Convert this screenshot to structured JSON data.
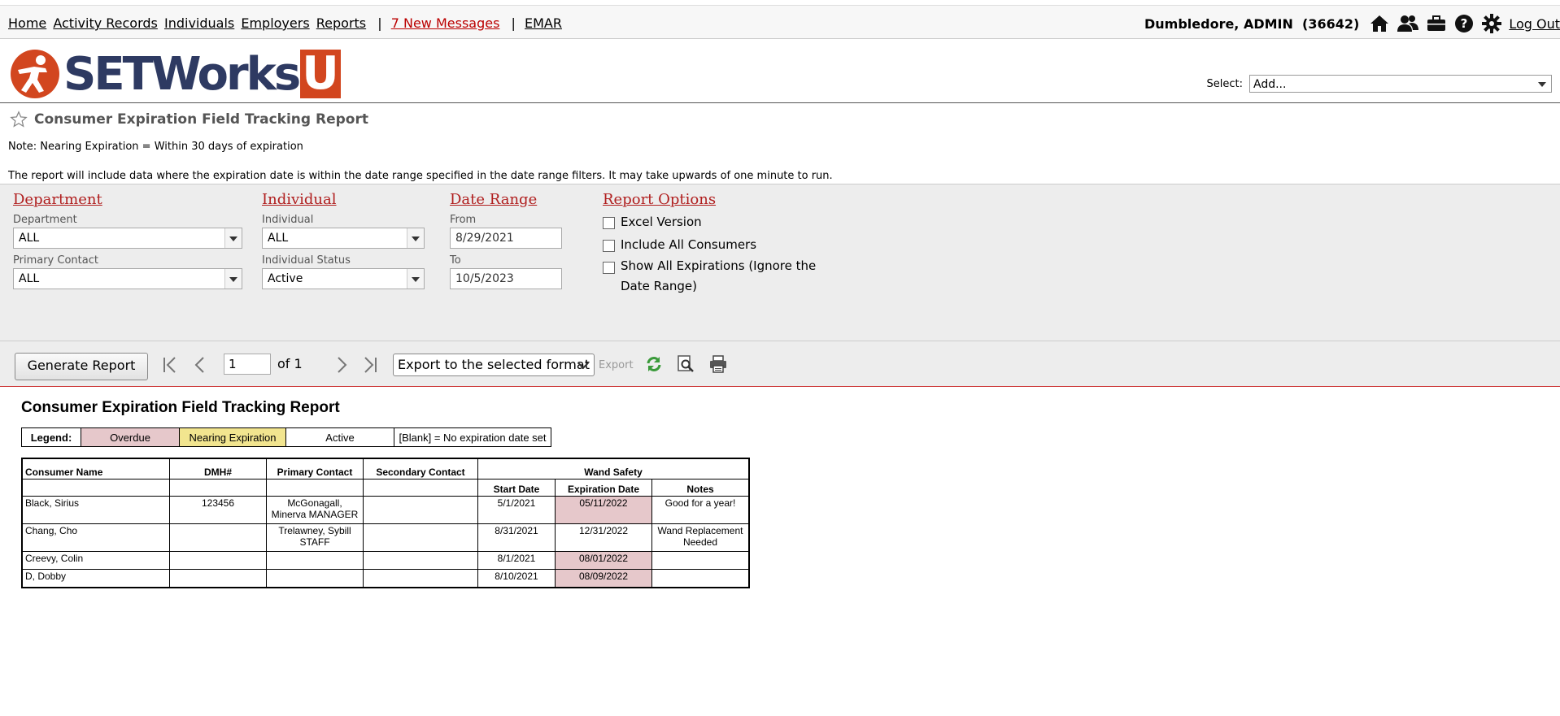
{
  "nav": {
    "home": "Home",
    "activity_records": "Activity Records",
    "individuals": "Individuals",
    "employers": "Employers",
    "reports": "Reports",
    "separator": "|",
    "messages": "7 New Messages",
    "emar": "EMAR"
  },
  "user": {
    "name": "Dumbledore, ADMIN",
    "id": "(36642)",
    "logout": "Log Out"
  },
  "logo": {
    "text": "SETWorks",
    "u": "U"
  },
  "select": {
    "label": "Select:",
    "value": "Add..."
  },
  "page": {
    "title": "Consumer Expiration Field Tracking Report",
    "note1": "Note: Nearing Expiration = Within 30 days of expiration",
    "note2": "The report will include data where the expiration date is within the date range specified in the date range filters. It may take upwards of one minute to run."
  },
  "filters": {
    "department": {
      "heading": "Department",
      "dept_label": "Department",
      "dept_value": "ALL",
      "contact_label": "Primary Contact",
      "contact_value": "ALL"
    },
    "individual": {
      "heading": "Individual",
      "ind_label": "Individual",
      "ind_value": "ALL",
      "status_label": "Individual Status",
      "status_value": "Active"
    },
    "date_range": {
      "heading": "Date Range",
      "from_label": "From",
      "from_value": "8/29/2021",
      "to_label": "To",
      "to_value": "10/5/2023"
    },
    "report_options": {
      "heading": "Report Options",
      "excel": "Excel Version",
      "include_all": "Include All Consumers",
      "show_all": "Show All Expirations (Ignore the Date Range)"
    }
  },
  "toolbar": {
    "generate": "Generate Report",
    "page_value": "1",
    "of": "of 1",
    "export_select": "Export to the selected format",
    "export_label": "Export"
  },
  "report": {
    "title": "Consumer Expiration Field Tracking Report",
    "legend": {
      "label": "Legend:",
      "overdue": "Overdue",
      "nearing": "Nearing Expiration",
      "active": "Active",
      "blank": "[Blank] = No expiration date set"
    },
    "headers": {
      "consumer_name": "Consumer Name",
      "dmh": "DMH#",
      "primary_contact": "Primary Contact",
      "secondary_contact": "Secondary Contact",
      "group": "Wand Safety",
      "start_date": "Start Date",
      "expiration_date": "Expiration Date",
      "notes": "Notes"
    },
    "rows": [
      {
        "name": "Black, Sirius",
        "dmh": "123456",
        "primary": "McGonagall, Minerva MANAGER",
        "secondary": "",
        "start": "5/1/2021",
        "expiration": "05/11/2022",
        "status": "overdue",
        "notes": "Good for a year!"
      },
      {
        "name": "Chang, Cho",
        "dmh": "",
        "primary": "Trelawney, Sybill STAFF",
        "secondary": "",
        "start": "8/31/2021",
        "expiration": "12/31/2022",
        "status": "active",
        "notes": "Wand Replacement Needed"
      },
      {
        "name": "Creevy, Colin",
        "dmh": "",
        "primary": "",
        "secondary": "",
        "start": "8/1/2021",
        "expiration": "08/01/2022",
        "status": "overdue",
        "notes": ""
      },
      {
        "name": "D, Dobby",
        "dmh": "",
        "primary": "",
        "secondary": "",
        "start": "8/10/2021",
        "expiration": "08/09/2022",
        "status": "overdue",
        "notes": ""
      }
    ]
  },
  "colors": {
    "overdue": "#e6c8cb",
    "nearing": "#f2e58f",
    "accent_red": "#b01e1e",
    "logo_navy": "#2e3a62",
    "logo_orange": "#d2461f"
  },
  "icons": [
    "home-icon",
    "users-icon",
    "briefcase-icon",
    "help-icon",
    "gear-icon",
    "star-icon",
    "first-page-icon",
    "prev-page-icon",
    "next-page-icon",
    "last-page-icon",
    "refresh-icon",
    "print-preview-icon",
    "print-icon"
  ]
}
